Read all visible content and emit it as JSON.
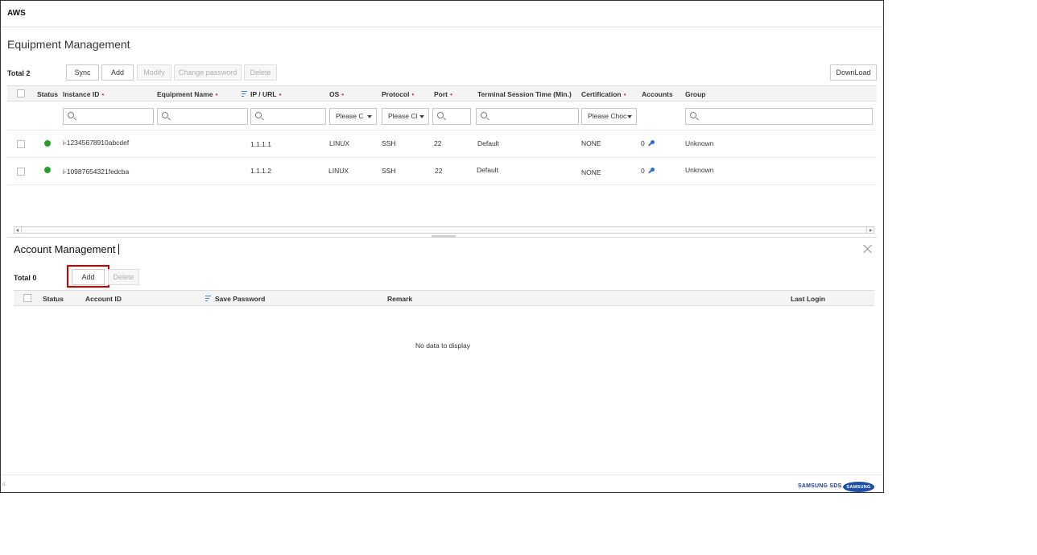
{
  "app": {
    "title": "AWS"
  },
  "equipment": {
    "title": "Equipment Management",
    "total": "Total 2",
    "toolbar": {
      "sync": "Sync",
      "add": "Add",
      "modify": "Modify",
      "change_password": "Change password",
      "delete": "Delete",
      "download": "DownLoad"
    },
    "columns": {
      "status": "Status",
      "instance_id": "Instance ID",
      "equipment_name": "Equipment Name",
      "ip_url": "IP / URL",
      "os": "OS",
      "protocol": "Protocol",
      "port": "Port",
      "terminal_session_time": "Terminal Session Time (Min.)",
      "certification": "Certification",
      "accounts": "Accounts",
      "group": "Group",
      "required_mark": "•"
    },
    "filters": {
      "os_select": "Please C",
      "protocol_select": "Please Cl",
      "certification_select": "Please Choc"
    },
    "rows": [
      {
        "status_color": "#2a9d2a",
        "instance_id": "i-12345678910abcdef",
        "equipment_name": "",
        "ip_url": "1.1.1.1",
        "os": "LINUX",
        "protocol": "SSH",
        "port": "22",
        "terminal_session_time": "Default",
        "certification": "NONE",
        "accounts": "0",
        "accounts_icon": "key-icon",
        "group": "Unknown"
      },
      {
        "status_color": "#2a9d2a",
        "instance_id": "i-10987654321fedcba",
        "equipment_name": "",
        "ip_url": "1.1.1.2",
        "os": "LINUX",
        "protocol": "SSH",
        "port": "22",
        "terminal_session_time": "Default",
        "certification": "NONE",
        "accounts": "0",
        "accounts_icon": "key-icon",
        "group": "Unknown"
      }
    ]
  },
  "account": {
    "title": "Account Management",
    "total": "Total 0",
    "toolbar": {
      "add": "Add",
      "delete": "Delete"
    },
    "highlighted_button": "add",
    "highlight_color": "#d40000",
    "columns": {
      "status": "Status",
      "account_id": "Account ID",
      "save_password": "Save Password",
      "remark": "Remark",
      "last_login": "Last Login"
    },
    "empty_message": "No data to display"
  },
  "footer": {
    "mark": "d.",
    "brand_text": "SAMSUNG SDS",
    "brand_logo": "SAMSUNG"
  }
}
